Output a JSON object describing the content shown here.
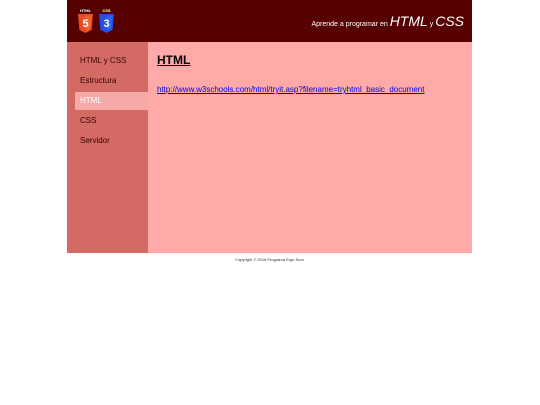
{
  "header": {
    "logos": [
      {
        "label": "HTML",
        "digit": "5",
        "color": "#e34c26"
      },
      {
        "label": "CSS",
        "digit": "3",
        "color": "#264de4"
      }
    ],
    "tagline_prefix": "Aprende a programar en ",
    "tagline_html": "HTML",
    "tagline_joiner": " y ",
    "tagline_css": "CSS"
  },
  "sidebar": {
    "items": [
      {
        "label": "HTML y CSS",
        "active": false
      },
      {
        "label": "Estructura",
        "active": false
      },
      {
        "label": "HTML",
        "active": true
      },
      {
        "label": "CSS",
        "active": false
      },
      {
        "label": "Servidor",
        "active": false
      }
    ]
  },
  "content": {
    "title": "HTML",
    "link": "http://www.w3schools.com/html/tryit.asp?filename=tryhtml_basic_document"
  },
  "footer": {
    "text": "Copyright © 2016 Programa Ergo Sum"
  },
  "colors": {
    "header_bg": "#560000",
    "sidebar_bg": "#d36a64",
    "content_bg": "#ffaaa8",
    "active_item_bg": "#f5aaa8"
  }
}
